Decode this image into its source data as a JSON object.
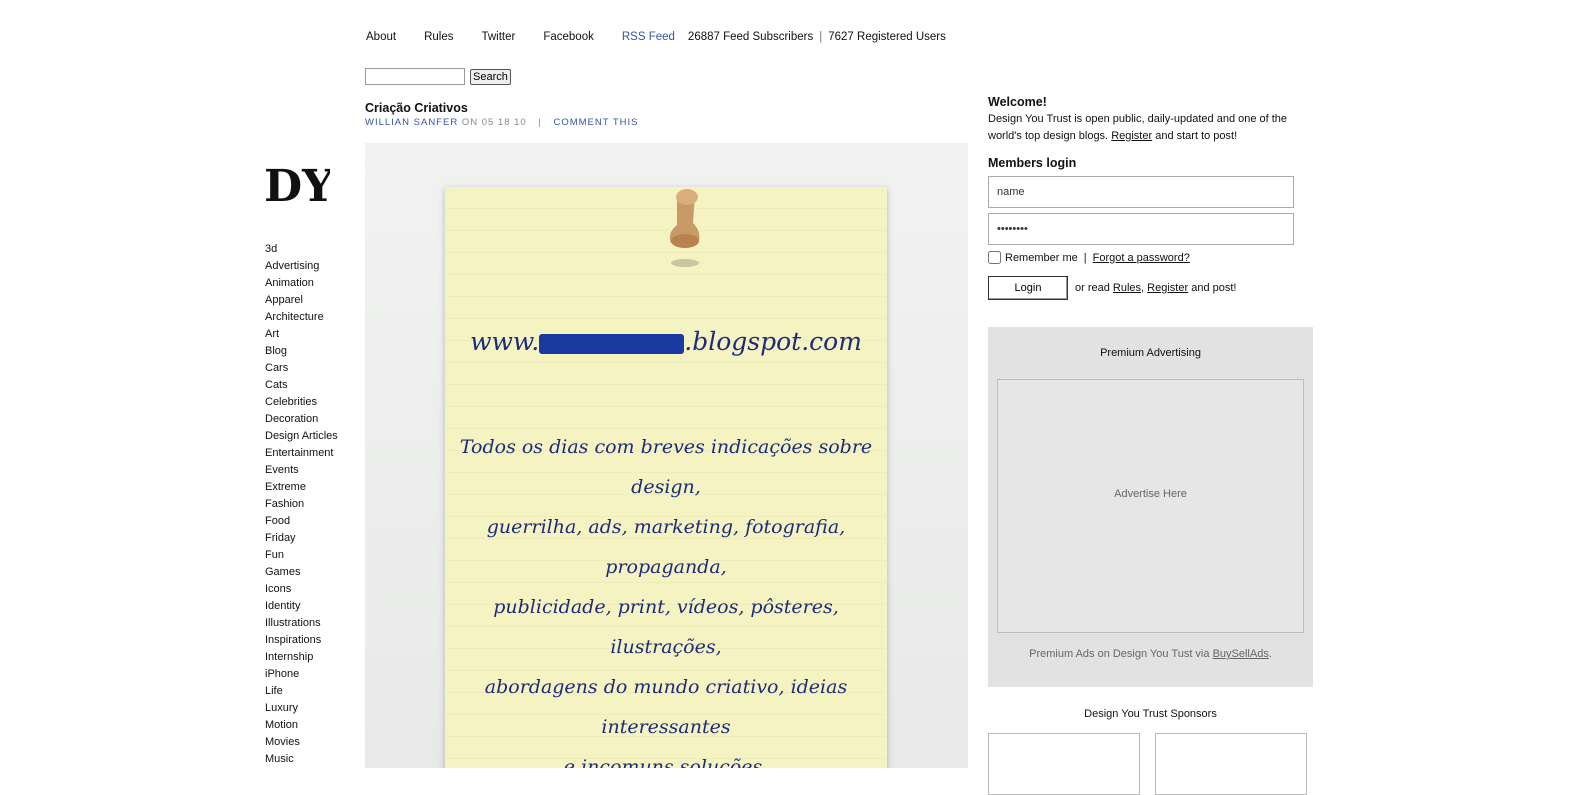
{
  "topnav": {
    "links": [
      "About",
      "Rules",
      "Twitter",
      "Facebook"
    ],
    "rss": "RSS Feed",
    "subscribers": "26887 Feed Subscribers",
    "separator": "|",
    "users": "7627 Registered Users"
  },
  "search": {
    "button": "Search",
    "value": ""
  },
  "logo": {
    "text": "DYT"
  },
  "categories": [
    "3d",
    "Advertising",
    "Animation",
    "Apparel",
    "Architecture",
    "Art",
    "Blog",
    "Cars",
    "Cats",
    "Celebrities",
    "Decoration",
    "Design Articles",
    "Entertainment",
    "Events",
    "Extreme",
    "Fashion",
    "Food",
    "Friday",
    "Fun",
    "Games",
    "Icons",
    "Identity",
    "Illustrations",
    "Inspirations",
    "Internship",
    "iPhone",
    "Life",
    "Luxury",
    "Motion",
    "Movies",
    "Music"
  ],
  "post": {
    "title": "Criação Criativos",
    "author": "WILLIAN SANFER",
    "on": "ON 05 18 10",
    "pipe": "|",
    "comment": "COMMENT THIS",
    "note_url_prefix": "www.",
    "note_url_suffix": ".blogspot.com",
    "note_lines": [
      "Todos os dias com breves indicações sobre design,",
      "guerrilha, ads, marketing, fotografia, propaganda,",
      "publicidade, print, vídeos, pôsteres, ilustrações,",
      "abordagens do mundo criativo, ideias interessantes",
      "e incomuns soluções."
    ]
  },
  "welcome": {
    "title": "Welcome!",
    "text_before": "Design You Trust is open public, daily-updated and one of the world's top design blogs.",
    "register": "Register",
    "text_after": "and start to post!"
  },
  "login": {
    "title": "Members login",
    "name_value": "name",
    "password_value": "••••••••",
    "remember": "Remember me",
    "pipe": "|",
    "forgot": "Forgot a password?",
    "button": "Login",
    "or_read": "or read",
    "rules": "Rules",
    "comma": ",",
    "register": "Register",
    "and_post": "and post!"
  },
  "premium": {
    "title": "Premium Advertising",
    "advertise": "Advertise Here",
    "foot_before": "Premium Ads on Design You Tust via",
    "foot_link": "BuySellAds",
    "foot_after": "."
  },
  "sponsors": {
    "title": "Design You Trust Sponsors"
  },
  "colors": {
    "link_blue": "#3355aa",
    "note_ink": "#1a2c7a",
    "sidebar_gray": "#e2e2e2"
  }
}
